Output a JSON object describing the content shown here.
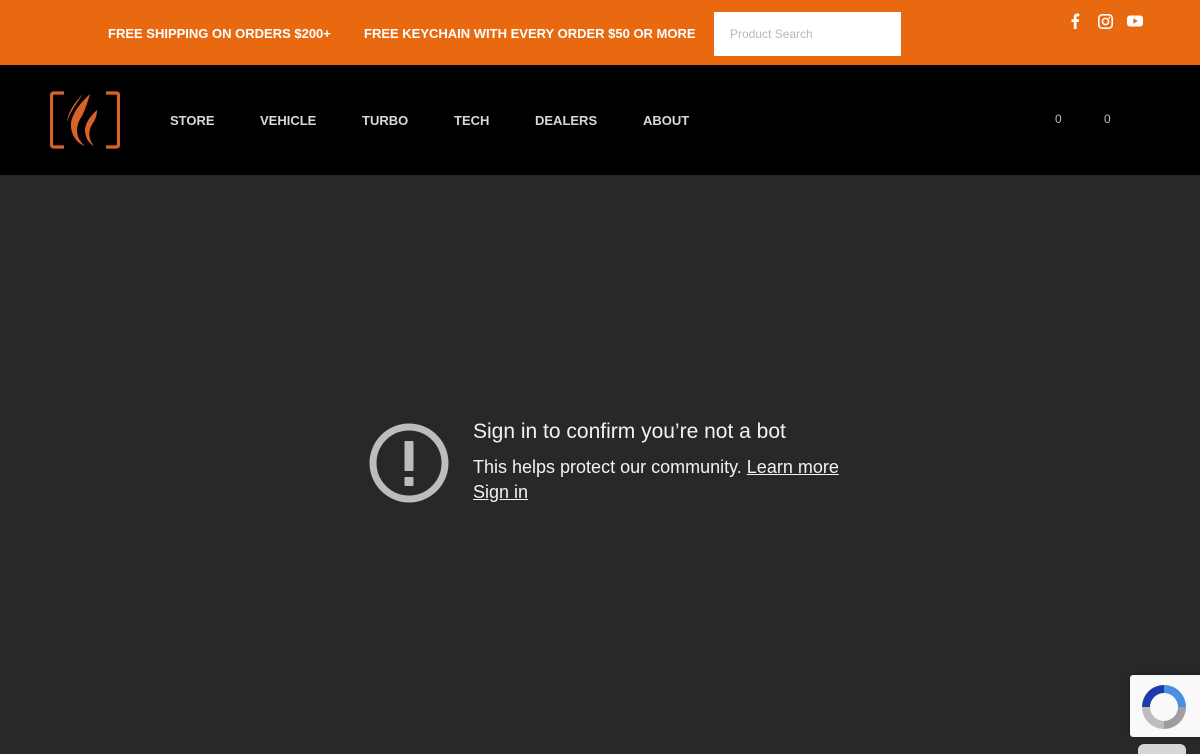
{
  "promo": {
    "shipping": "FREE SHIPPING ON ORDERS $200+",
    "keychain": "FREE KEYCHAIN WITH EVERY ORDER $50 OR MORE",
    "search_placeholder": "Product Search"
  },
  "social": {
    "facebook_icon": "facebook-icon",
    "instagram_icon": "instagram-icon",
    "youtube_icon": "youtube-icon"
  },
  "nav": {
    "items": [
      "STORE",
      "VEHICLE",
      "TURBO",
      "TECH",
      "DEALERS",
      "ABOUT"
    ],
    "count_a": "0",
    "count_b": "0"
  },
  "notice": {
    "title": "Sign in to confirm you’re not a bot",
    "subtitle": "This helps protect our community.",
    "learn_more": "Learn more",
    "sign_in": "Sign in"
  },
  "colors": {
    "accent": "#e8690f",
    "nav_bg": "#000000",
    "page_bg": "#282828",
    "logo": "#d9622b"
  }
}
